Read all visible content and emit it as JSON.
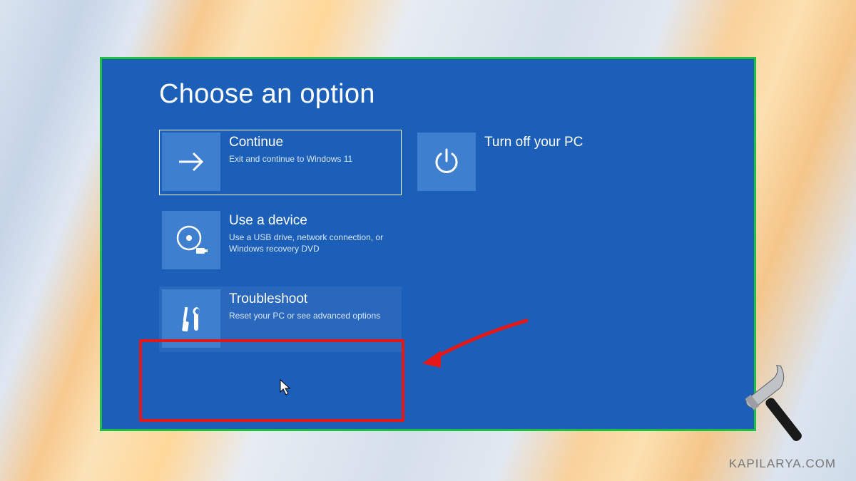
{
  "page_title": "Choose an option",
  "tiles": {
    "continue": {
      "title": "Continue",
      "desc": "Exit and continue to Windows 11"
    },
    "turnoff": {
      "title": "Turn off your PC",
      "desc": ""
    },
    "usedevice": {
      "title": "Use a device",
      "desc": "Use a USB drive, network connection, or Windows recovery DVD"
    },
    "troubleshoot": {
      "title": "Troubleshoot",
      "desc": "Reset your PC or see advanced options"
    }
  },
  "watermark": "KAPILARYA.COM"
}
